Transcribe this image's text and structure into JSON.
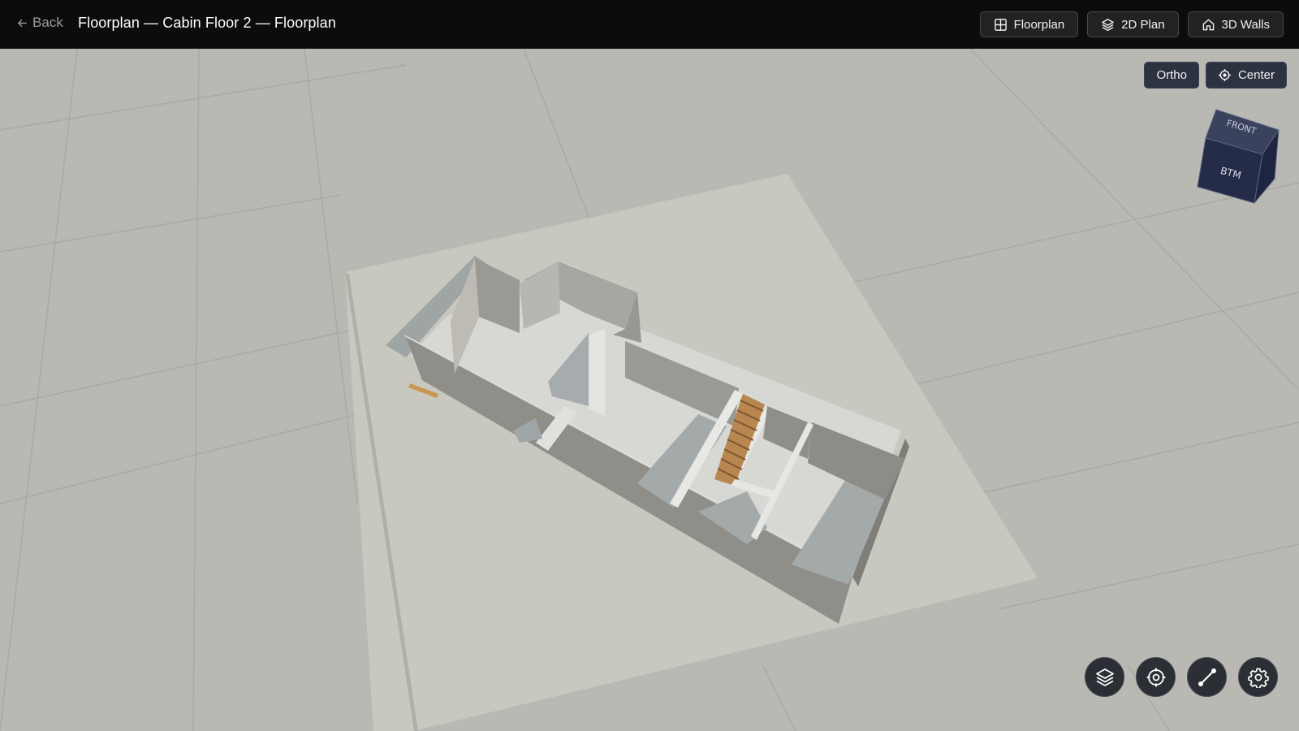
{
  "header": {
    "back_label": "Back",
    "title": "Floorplan — Cabin Floor 2 — Floorplan",
    "view_modes": [
      {
        "label": "Floorplan",
        "icon": "grid-icon"
      },
      {
        "label": "2D Plan",
        "icon": "layers-icon"
      },
      {
        "label": "3D Walls",
        "icon": "home-icon"
      }
    ]
  },
  "viewport": {
    "ortho_label": "Ortho",
    "center_label": "Center",
    "cube_faces": {
      "front": "FRONT",
      "bottom": "BTM"
    },
    "tools": [
      {
        "name": "layers-tool",
        "icon": "layers-icon"
      },
      {
        "name": "target-tool",
        "icon": "target-icon"
      },
      {
        "name": "measure-tool",
        "icon": "measure-line-icon"
      },
      {
        "name": "settings-tool",
        "icon": "gear-icon"
      }
    ]
  },
  "colors": {
    "topbar": "#0c0c0c",
    "ground": "#b9b8b2",
    "floor_slab": "#c8c8c0",
    "wall_dark": "#8f8e88",
    "button_dark": "#2d3241",
    "cube": "#26304e",
    "stairs": "#b8864f"
  }
}
